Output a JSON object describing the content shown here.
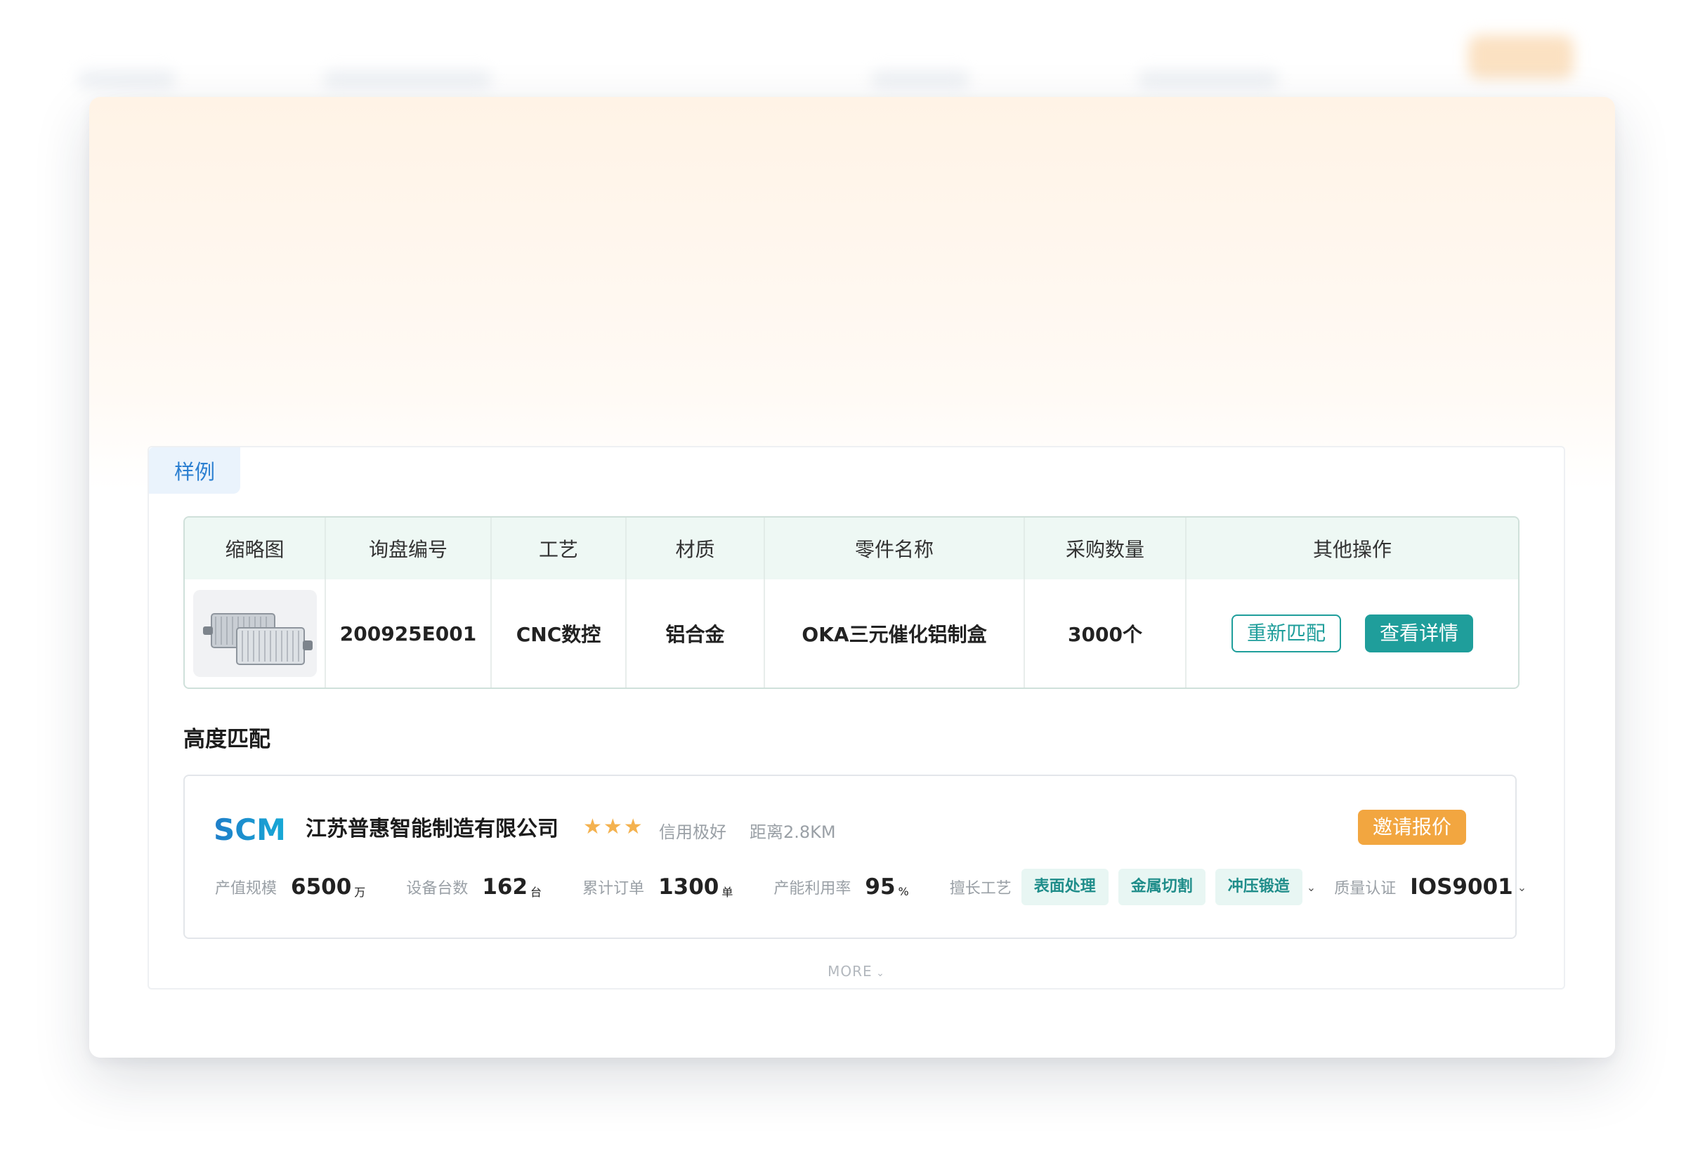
{
  "sample_tab": "样例",
  "table": {
    "headers": [
      "缩略图",
      "询盘编号",
      "工艺",
      "材质",
      "零件名称",
      "采购数量",
      "其他操作"
    ],
    "row": {
      "inquiry_no": "200925E001",
      "process": "CNC数控",
      "material": "铝合金",
      "part_name": "OKA三元催化铝制盒",
      "quantity": "3000个",
      "rematch_label": "重新匹配",
      "details_label": "查看详情"
    }
  },
  "section_title": "高度匹配",
  "supplier": {
    "logo_text": "SCM",
    "name": "江苏普惠智能制造有限公司",
    "stars": "★★★",
    "rating_text": "信用极好",
    "distance": "距离2.8KM",
    "invite_label": "邀请报价",
    "metrics": {
      "scale_label": "产值规模",
      "scale_value": "6500",
      "scale_unit": "万",
      "equipment_label": "设备台数",
      "equipment_value": "162",
      "equipment_unit": "台",
      "orders_label": "累计订单",
      "orders_value": "1300",
      "orders_unit": "单",
      "utilization_label": "产能利用率",
      "utilization_value": "95",
      "utilization_unit": "%",
      "skills_label": "擅长工艺",
      "skills": [
        "表面处理",
        "金属切割",
        "冲压锻造"
      ],
      "cert_label": "质量认证",
      "cert_value": "IOS9001"
    }
  },
  "more_label": "MORE",
  "colors": {
    "teal": "#1f9e9b",
    "orange": "#f2a640",
    "blue": "#2b7fd1"
  }
}
